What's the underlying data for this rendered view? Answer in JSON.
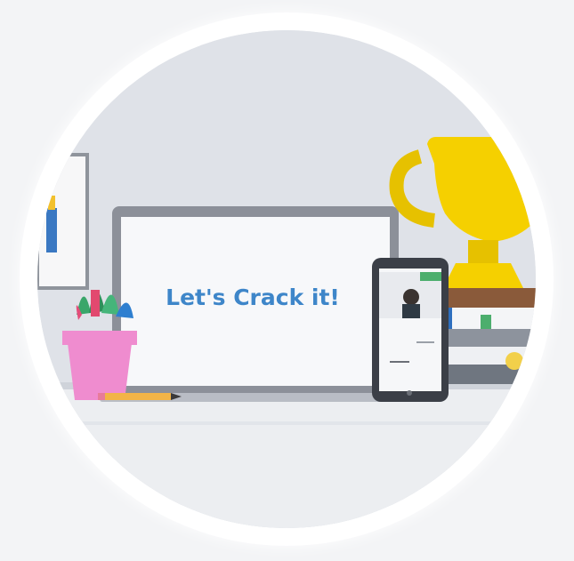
{
  "scene": {
    "headline": "Let's Crack it!"
  },
  "icons": [
    "trophy-icon",
    "laptop-icon",
    "tablet-icon",
    "plant-pot-icon",
    "pencil-icon",
    "books-icon",
    "picture-frame-icon"
  ],
  "colors": {
    "background": "#f3f4f6",
    "ring": "#ffffff",
    "scene_bg": "#dfe2e8",
    "headline": "#3e86c9",
    "trophy_gold": "#f5d000",
    "pot_pink": "#ef8ccf",
    "book_blue": "#2e6fbf",
    "book_green": "#4cae6d",
    "book_brown": "#8a5a3a",
    "desk": "#eceef1"
  }
}
